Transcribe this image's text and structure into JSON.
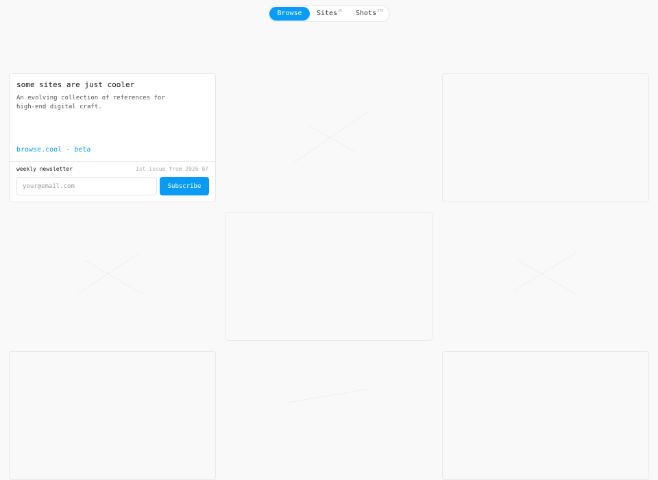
{
  "nav": {
    "tabs": [
      {
        "label": "Browse",
        "count": ""
      },
      {
        "label": "Sites",
        "count": "26"
      },
      {
        "label": "Shots",
        "count": "379"
      }
    ]
  },
  "card": {
    "title": "some sites are just cooler",
    "description": "An evolving collection of references for high-end digital craft.",
    "link": "browse.cool - beta",
    "newsletter_label": "weekly newsletter",
    "newsletter_date": "1st issue from 2026 07",
    "email_placeholder": "your@email.com",
    "subscribe_label": "Subscribe"
  },
  "colors": {
    "accent": "#0a9bf5",
    "background": "#f9f9f9"
  }
}
